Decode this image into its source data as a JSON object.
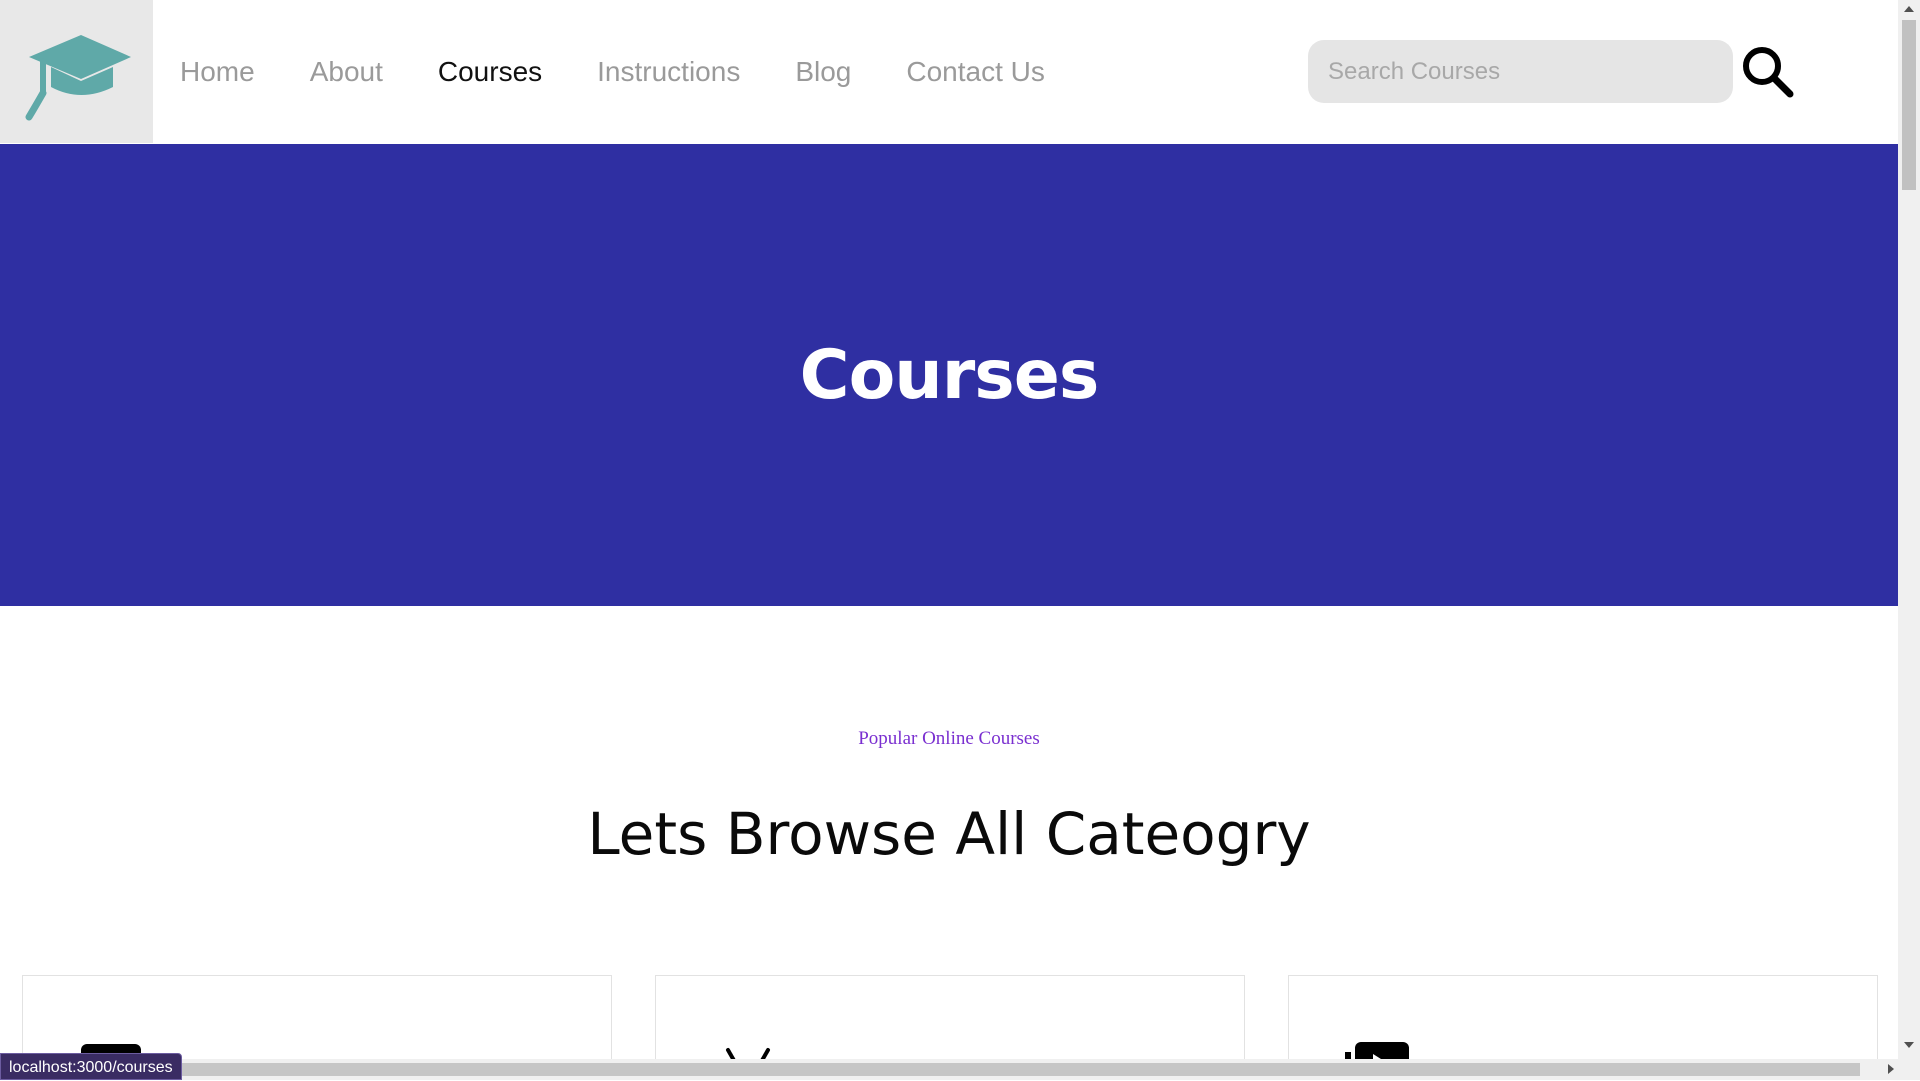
{
  "header": {
    "logo_alt": "graduation-cap-logo",
    "nav": [
      {
        "label": "Home",
        "active": false
      },
      {
        "label": "About",
        "active": false
      },
      {
        "label": "Courses",
        "active": true
      },
      {
        "label": "Instructions",
        "active": false
      },
      {
        "label": "Blog",
        "active": false
      },
      {
        "label": "Contact Us",
        "active": false
      }
    ],
    "search": {
      "placeholder": "Search Courses",
      "value": ""
    },
    "search_icon": "search-icon"
  },
  "hero": {
    "title": "Courses",
    "background": "#2f2fa2"
  },
  "section": {
    "eyebrow": "Popular Online Courses",
    "title": "Lets Browse All Cateogry"
  },
  "cards": [
    {
      "icon": "monitor-icon"
    },
    {
      "icon": "android-icon"
    },
    {
      "icon": "video-play-icon"
    }
  ],
  "status_bar": {
    "url": "localhost:3000/courses"
  },
  "colors": {
    "logo_teal": "#5fa9a8",
    "hero_blue": "#2f2fa2",
    "eyebrow_purple": "#7a2fd0",
    "nav_inactive": "#9a9a9a",
    "nav_active": "#111111"
  }
}
